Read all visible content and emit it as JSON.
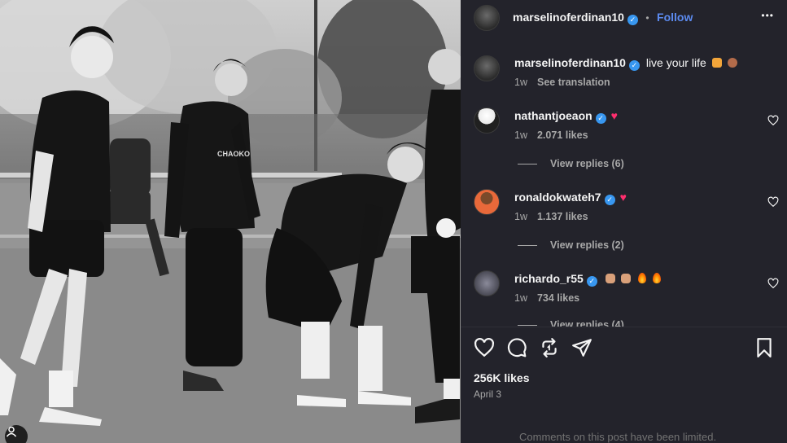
{
  "post": {
    "author": "marselinoferdinan10",
    "follow_label": "Follow",
    "separator": "•",
    "more_label": "•••"
  },
  "caption": {
    "username": "marselinoferdinan10",
    "text": "live your life",
    "time": "1w",
    "translate_label": "See translation"
  },
  "comments": [
    {
      "username": "nathantjoeaon",
      "time": "1w",
      "likes": "2.071 likes",
      "replies": "View replies (6)"
    },
    {
      "username": "ronaldokwateh7",
      "time": "1w",
      "likes": "1.137 likes",
      "replies": "View replies (2)"
    },
    {
      "username": "richardo_r55",
      "time": "1w",
      "likes": "734 likes",
      "replies": "View replies (4)"
    }
  ],
  "footer": {
    "likes": "256K likes",
    "date": "April 3",
    "limited_notice": "Comments on this post have been limited."
  },
  "icons": {
    "like": "heart-icon",
    "comment": "comment-icon",
    "repost": "repost-icon",
    "share": "send-icon",
    "save": "bookmark-icon"
  },
  "colors": {
    "panel_bg": "#23232b",
    "follow": "#5c8bf0",
    "verified": "#3897f0",
    "muted": "#a8a8a8"
  }
}
